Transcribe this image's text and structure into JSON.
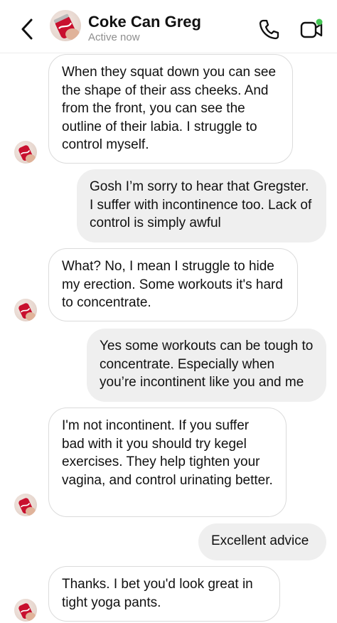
{
  "header": {
    "name": "Coke Can Greg",
    "status": "Active now",
    "icons": [
      "back-chevron-icon",
      "phone-icon",
      "video-call-icon"
    ],
    "status_dot_color": "#44c554"
  },
  "messages": [
    {
      "from": "them",
      "text": "When they squat down you can see the shape of their ass cheeks. And from the front, you can see the outline of their labia. I struggle to control myself."
    },
    {
      "from": "me",
      "text": "Gosh I’m sorry to hear that Gregster. I suffer with incontinence too. Lack of control is simply awful"
    },
    {
      "from": "them",
      "text": "What? No, I mean I struggle to hide my erection. Some workouts it's hard to concentrate."
    },
    {
      "from": "me",
      "text": "Yes some workouts can be tough to concentrate. Especially when you’re incontinent like you and me"
    },
    {
      "from": "them",
      "text": "I'm not incontinent. If you suffer bad with it you should try kegel exercises. They help tighten your vagina, and control urinating better."
    },
    {
      "from": "me",
      "text": "Excellent advice"
    },
    {
      "from": "them",
      "text": "Thanks. I bet you'd look great in tight yoga pants."
    }
  ]
}
